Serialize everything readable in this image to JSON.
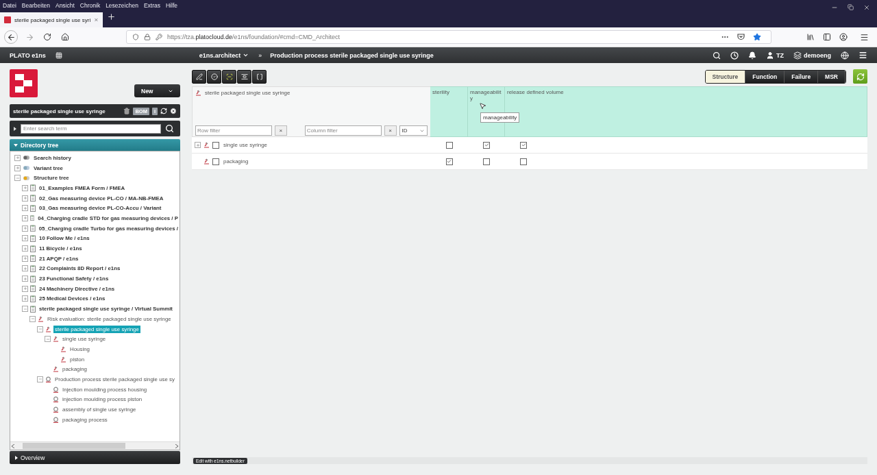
{
  "browser": {
    "menu": [
      "Datei",
      "Bearbeiten",
      "Ansicht",
      "Chronik",
      "Lesezeichen",
      "Extras",
      "Hilfe"
    ],
    "tab_title": "sterile packaged single use syri",
    "url_prefix": "https://tza.",
    "url_domain": "platocloud.de",
    "url_path": "/e1ns/foundation/#cmd=CMD_Architect",
    "bookmarked": true
  },
  "app_header": {
    "product": "PLATO e1ns",
    "module": "e1ns.architect",
    "separator": "»",
    "title": "Production process sterile packaged single use syringe",
    "user": "TZ",
    "workspace": "demoeng"
  },
  "sidebar": {
    "new_button": "New",
    "object_title": "sterile packaged single use syringe",
    "bom": "BOM",
    "info": "i",
    "search_placeholder": "Enter search term",
    "tree_title": "Directory tree",
    "tree_expanded": true,
    "tree": [
      {
        "label": "Search history",
        "kind": "history",
        "expanded": false,
        "selected": false
      },
      {
        "label": "Variant tree",
        "kind": "variant",
        "expanded": false,
        "selected": false
      },
      {
        "label": "Structure tree",
        "kind": "structure",
        "expanded": true,
        "selected": false,
        "children": [
          {
            "label": "01_Examples FMEA Form / FMEA",
            "kind": "project",
            "expanded": false,
            "selected": false
          },
          {
            "label": "02_Gas measuring device PL-CO / MA-NB-FMEA",
            "kind": "project",
            "expanded": false,
            "selected": false
          },
          {
            "label": "03_Gas measuring device PL-CO-Accu / Variant",
            "kind": "project",
            "expanded": false,
            "selected": false
          },
          {
            "label": "04_Charging cradle STD for gas measuring devices / P",
            "kind": "project",
            "expanded": false,
            "selected": false
          },
          {
            "label": "05_Charging cradle Turbo for gas measuring devices /",
            "kind": "project",
            "expanded": false,
            "selected": false
          },
          {
            "label": "10 Follow Me / e1ns",
            "kind": "project",
            "expanded": false,
            "selected": false
          },
          {
            "label": "11 Bicycle / e1ns",
            "kind": "project",
            "expanded": false,
            "selected": false
          },
          {
            "label": "21 APQP / e1ns",
            "kind": "project",
            "expanded": false,
            "selected": false
          },
          {
            "label": "22 Complaints 8D Report / e1ns",
            "kind": "project",
            "expanded": false,
            "selected": false
          },
          {
            "label": "23 Functional Safety / e1ns",
            "kind": "project",
            "expanded": false,
            "selected": false
          },
          {
            "label": "24 Machinery Directive / e1ns",
            "kind": "project",
            "expanded": false,
            "selected": false
          },
          {
            "label": "25 Medical Devices / e1ns",
            "kind": "project",
            "expanded": false,
            "selected": false
          },
          {
            "label": "sterile packaged single use syringe / Virtual Summit",
            "kind": "project",
            "expanded": true,
            "selected": false,
            "children": [
              {
                "label": "Risk evaluation: sterile packaged single use syringe",
                "kind": "element",
                "expanded": true,
                "selected": false,
                "children": [
                  {
                    "label": "sterile packaged single use syringe",
                    "kind": "element",
                    "expanded": true,
                    "selected": true,
                    "children": [
                      {
                        "label": "single use syringe",
                        "kind": "element",
                        "expanded": true,
                        "selected": false,
                        "children": [
                          {
                            "label": "Housing",
                            "kind": "element",
                            "selected": false
                          },
                          {
                            "label": "piston",
                            "kind": "element",
                            "selected": false
                          }
                        ]
                      },
                      {
                        "label": "packaging",
                        "kind": "element",
                        "selected": false
                      }
                    ]
                  },
                  {
                    "label": "Production process sterile packaged single use sy",
                    "kind": "process",
                    "expanded": true,
                    "selected": false,
                    "children": [
                      {
                        "label": "Injection moulding process housing",
                        "kind": "process",
                        "selected": false
                      },
                      {
                        "label": "injection moulding process piston",
                        "kind": "process",
                        "selected": false
                      },
                      {
                        "label": "assembly of single use syringe",
                        "kind": "process",
                        "selected": false
                      },
                      {
                        "label": "packaging process",
                        "kind": "process",
                        "selected": false
                      }
                    ]
                  }
                ]
              }
            ]
          }
        ]
      }
    ],
    "overview": "Overview"
  },
  "toolbar": [
    {
      "kind": "edit",
      "on": false
    },
    {
      "kind": "check",
      "on": false
    },
    {
      "kind": "frame",
      "on": true
    },
    {
      "kind": "fit",
      "on": false
    },
    {
      "kind": "bracket",
      "on": false
    }
  ],
  "view_tabs": [
    {
      "label": "Structure",
      "selected": true
    },
    {
      "label": "Function",
      "selected": false
    },
    {
      "label": "Failure",
      "selected": false
    },
    {
      "label": "MSR",
      "selected": false
    }
  ],
  "table": {
    "title": "sterile packaged single use syringe",
    "row_filter_placeholder": "Row filter",
    "row_filter_clear": "×",
    "column_filter_placeholder": "Column filter",
    "column_filter_clear": "×",
    "id_select": "ID",
    "columns": [
      "sterility",
      "manageability",
      "release defined volume"
    ],
    "rows": [
      {
        "label": "single use syringe",
        "expanded": false,
        "checked": false,
        "cells": [
          {
            "checked": false
          },
          {
            "checked": true
          },
          {
            "checked": true
          }
        ]
      },
      {
        "label": "packaging",
        "checked": false,
        "cells": [
          {
            "checked": true
          },
          {
            "checked": false
          },
          {
            "checked": false
          }
        ]
      }
    ],
    "tooltip": "manageability"
  },
  "footer": {
    "edit_link": "Edit with e1ns.netbuilder"
  }
}
